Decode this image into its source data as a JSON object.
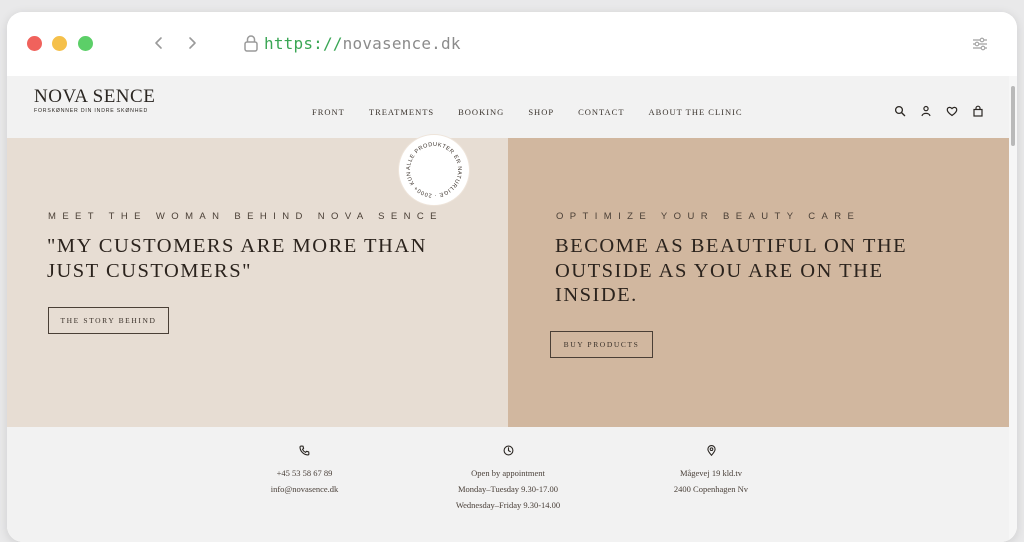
{
  "browser": {
    "url_scheme": "https://",
    "url_host": "novasence.dk",
    "icons": [
      "lock-icon",
      "back-icon",
      "forward-icon",
      "settings-icon"
    ]
  },
  "site": {
    "logo_main": "NOVA SENCE",
    "logo_sub": "FORSKØNNER DIN INDRE SKØNHED",
    "menu": [
      "FRONT",
      "TREATMENTS",
      "BOOKING",
      "SHOP",
      "CONTACT",
      "ABOUT THE CLINIC"
    ],
    "header_icons": [
      "search-icon",
      "account-icon",
      "wishlist-icon",
      "cart-icon"
    ]
  },
  "hero_left": {
    "eyebrow": "MEET THE WOMAN BEHIND NOVA SENCE",
    "headline_line1": "\"MY CUSTOMERS ARE MORE THAN",
    "headline_line2": "JUST CUSTOMERS\"",
    "cta": "THE STORY BEHIND",
    "badge_text": "ALLE PRODUKTER ER NATURLIGE · 2000+ KUNDER ·"
  },
  "hero_right": {
    "eyebrow": "OPTIMIZE YOUR BEAUTY CARE",
    "headline_line1": "BECOME AS BEAUTIFUL ON THE",
    "headline_line2": "OUTSIDE AS YOU ARE ON THE",
    "headline_line3": "INSIDE.",
    "cta": "BUY PRODUCTS"
  },
  "info": {
    "contact": {
      "icon": "phone-icon",
      "phone": "+45 53 58 67 89",
      "email": "info@novasence.dk"
    },
    "hours": {
      "icon": "clock-icon",
      "line1": "Open by appointment",
      "line2": "Monday–Tuesday 9.30-17.00",
      "line3": "Wednesday–Friday 9.30-14.00"
    },
    "address": {
      "icon": "location-pin-icon",
      "street": "Mågevej 19 kld.tv",
      "city": "2400 Copenhagen Nv"
    }
  },
  "colors": {
    "hero_left_bg": "#e7ddd3",
    "hero_right_bg": "#d1b79f",
    "url_scheme": "#3aa655"
  }
}
